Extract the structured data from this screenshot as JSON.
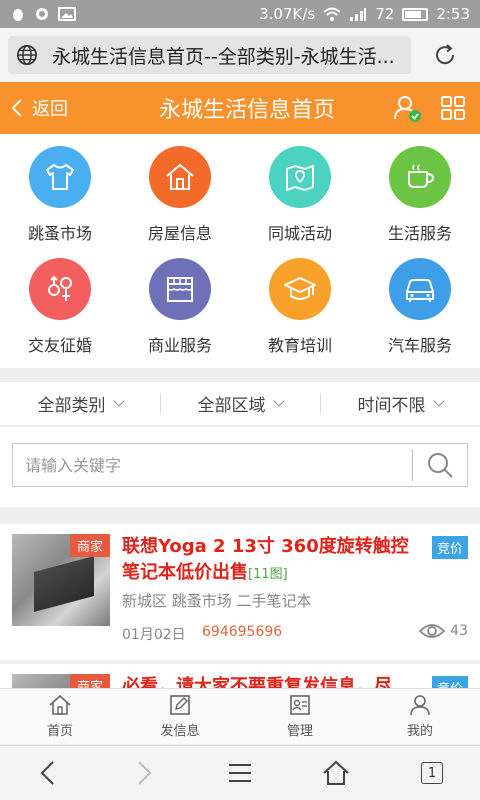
{
  "status_bar": {
    "speed": "3.07K/s",
    "battery": "72",
    "battery_level": 0.72,
    "time": "2:53"
  },
  "browser": {
    "url_title": "永城生活信息首页--全部类别-永城生活..."
  },
  "header": {
    "back_label": "返回",
    "title": "永城生活信息首页",
    "accent": "#f7922d"
  },
  "categories": [
    {
      "label": "跳蚤市场",
      "icon": "tshirt-icon",
      "color": "#4aaef0"
    },
    {
      "label": "房屋信息",
      "icon": "house-icon",
      "color": "#f36b2a"
    },
    {
      "label": "同城活动",
      "icon": "map-icon",
      "color": "#4cd2c0"
    },
    {
      "label": "生活服务",
      "icon": "cup-icon",
      "color": "#6cc445"
    },
    {
      "label": "交友征婚",
      "icon": "gender-icon",
      "color": "#f35f5f"
    },
    {
      "label": "商业服务",
      "icon": "shop-icon",
      "color": "#6e71b8"
    },
    {
      "label": "教育培训",
      "icon": "graduation-cap-icon",
      "color": "#f7a12a"
    },
    {
      "label": "汽车服务",
      "icon": "car-icon",
      "color": "#3f9ee8"
    }
  ],
  "filters": {
    "category": "全部类别",
    "area": "全部区域",
    "time": "时间不限"
  },
  "search": {
    "placeholder": "请输入关键字"
  },
  "listings": [
    {
      "tag": "商家",
      "title": "联想Yoga 2 13寸 360度旋转触控笔记本低价出售",
      "image_count": "[11图]",
      "bid": "竞价",
      "location": "新城区 跳蚤市场 二手笔记本",
      "date": "01月02日",
      "phone": "694695696",
      "views": "43"
    },
    {
      "tag": "商家",
      "title": "必看，请大家不要重复发信息，尽",
      "bid": "竞价"
    }
  ],
  "app_nav": {
    "home": "首页",
    "post": "发信息",
    "manage": "管理",
    "mine": "我的"
  },
  "browser_bar": {
    "tab_count": "1"
  }
}
